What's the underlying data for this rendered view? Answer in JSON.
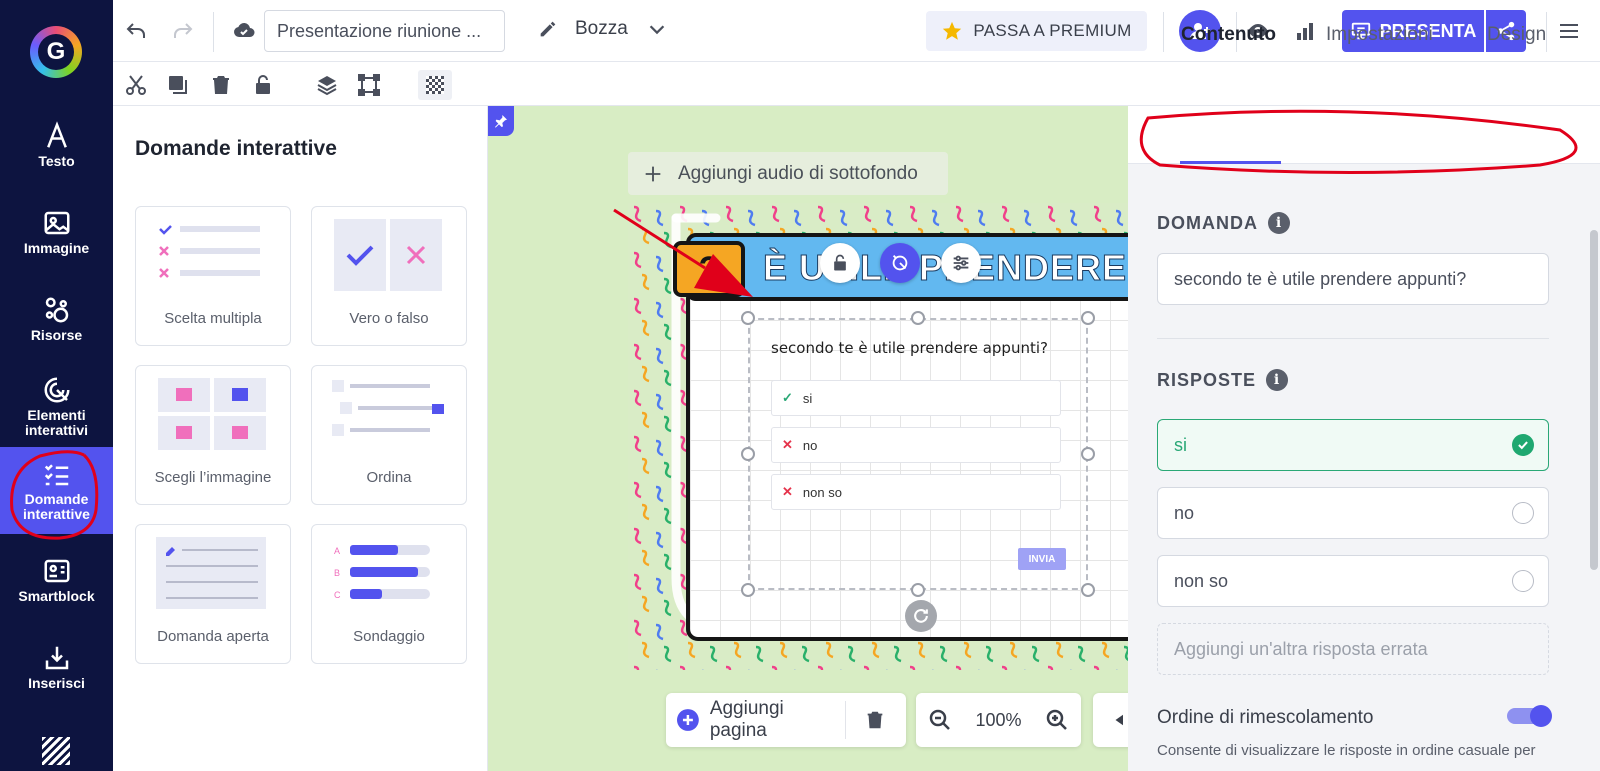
{
  "rail": {
    "logo_glyph": "G",
    "items": [
      {
        "label": "Testo",
        "icon": "text-icon"
      },
      {
        "label": "Immagine",
        "icon": "image-icon"
      },
      {
        "label": "Risorse",
        "icon": "resources-icon"
      },
      {
        "label": "Elementi interattivi",
        "icon": "interactive-elements-icon"
      },
      {
        "label": "Domande interattive",
        "icon": "interactive-questions-icon",
        "active": true
      },
      {
        "label": "Smartblock",
        "icon": "smartblock-icon"
      },
      {
        "label": "Inserisci",
        "icon": "insert-icon"
      }
    ]
  },
  "topbar": {
    "title_value": "Presentazione riunione ...",
    "draft_label": "Bozza",
    "premium_label": "PASSA A PREMIUM",
    "present_label": "PRESENTA"
  },
  "panel": {
    "title": "Domande interattive",
    "cards": [
      {
        "label": "Scelta multipla"
      },
      {
        "label": "Vero o falso"
      },
      {
        "label": "Scegli l’immagine"
      },
      {
        "label": "Ordina"
      },
      {
        "label": "Domanda aperta"
      },
      {
        "label": "Sondaggio"
      }
    ],
    "poll_letters": [
      "A",
      "B",
      "C"
    ],
    "poll_fill_fraction": [
      0.6,
      0.85,
      0.4
    ]
  },
  "canvas": {
    "audio_label": "Aggiungi audio di sottofondo",
    "banner_badge": "?",
    "banner_title": "È UTILE PRENDERE AP",
    "question": "secondo te è utile prendere appunti?",
    "answers": [
      {
        "text": "si",
        "mark": "✓",
        "correct": true
      },
      {
        "text": "no",
        "mark": "✕",
        "correct": false
      },
      {
        "text": "non so",
        "mark": "✕",
        "correct": false
      }
    ],
    "submit_label": "INVIA"
  },
  "bottom": {
    "add_page_label": "Aggiungi pagina",
    "zoom_label": "100%"
  },
  "rpanel": {
    "tabs": [
      "Contenuto",
      "Impostazioni",
      "Design"
    ],
    "active_tab": "Contenuto",
    "question_title": "DOMANDA",
    "question_value": "secondo te è utile prendere appunti?",
    "answers_title": "RISPOSTE",
    "answers": [
      {
        "text": "si",
        "correct": true
      },
      {
        "text": "no",
        "correct": false
      },
      {
        "text": "non so",
        "correct": false
      }
    ],
    "add_wrong_placeholder": "Aggiungi un'altra risposta errata",
    "shuffle_label": "Ordine di rimescolamento",
    "shuffle_on": true,
    "shuffle_desc": "Consente di visualizzare le risposte in ordine casuale per"
  },
  "colors": {
    "brand": "#5353ee",
    "rail_bg": "#0d1440",
    "correct": "#2aa876",
    "wrong": "#e5334b",
    "annotation": "#e0001a"
  }
}
